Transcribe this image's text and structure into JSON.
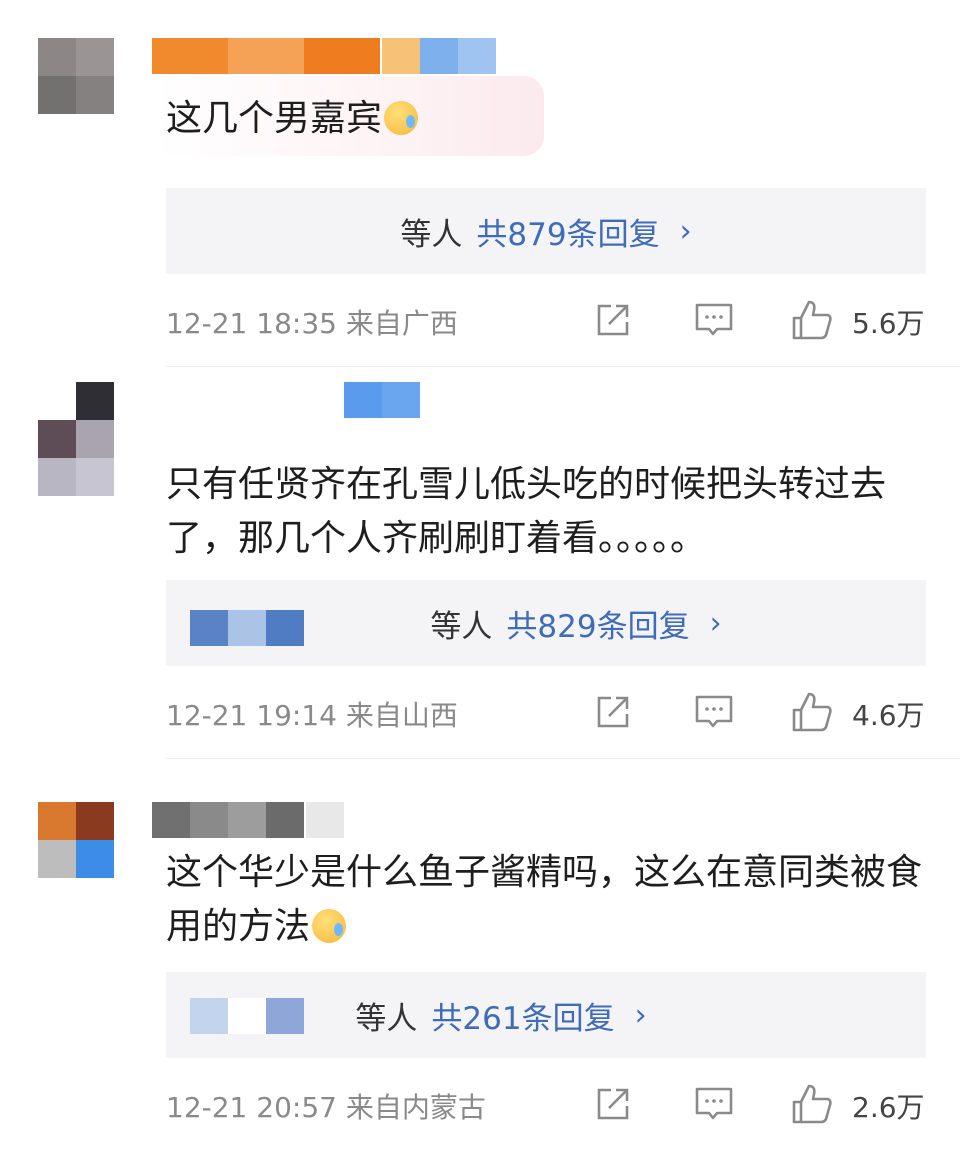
{
  "comments": [
    {
      "text": "这几个男嘉宾",
      "reply_prefix": "等人",
      "reply_count": "共879条回复",
      "time": "12-21 18:35",
      "location": "来自广西",
      "likes": "5.6万"
    },
    {
      "text": "只有任贤齐在孔雪儿低头吃的时候把头转过去了，那几个人齐刷刷盯着看。。。。。",
      "reply_prefix": "等人",
      "reply_count": "共829条回复",
      "time": "12-21 19:14",
      "location": "来自山西",
      "likes": "4.6万"
    },
    {
      "text": "这个华少是什么鱼子酱精吗，这么在意同类被食用的方法",
      "reply_prefix": "等人",
      "reply_count": "共261条回复",
      "time": "12-21 20:57",
      "location": "来自内蒙古",
      "likes": "2.6万"
    }
  ],
  "icons": {
    "share": "share-icon",
    "comment": "comment-icon",
    "like": "thumbs-up-icon",
    "emoji": "crying-face-emoji-icon",
    "chevron": "chevron-right-icon"
  },
  "colors": {
    "reply_link": "#3f6bb8",
    "reply_bg": "#f4f4f6",
    "meta_text": "#8a8a8a"
  },
  "glyphs": {
    "chevron": "›"
  }
}
